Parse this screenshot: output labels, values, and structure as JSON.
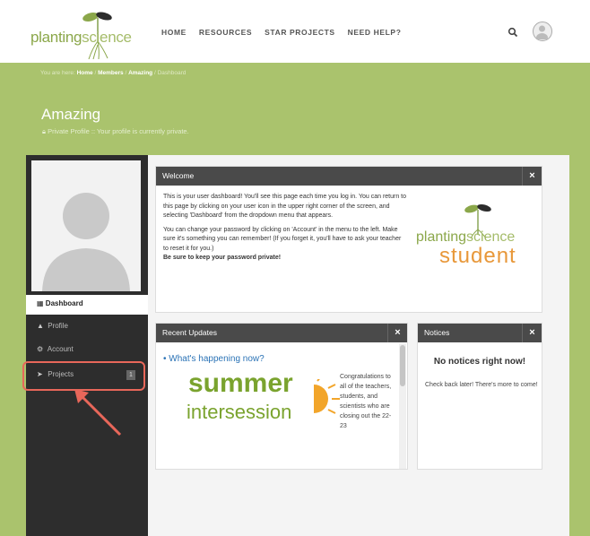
{
  "header": {
    "logo_left": "planting",
    "logo_right": "science",
    "nav": [
      "HOME",
      "RESOURCES",
      "STAR PROJECTS",
      "NEED HELP?"
    ]
  },
  "breadcrumb": {
    "prefix": "You are here:",
    "items": [
      "Home",
      "Members",
      "Amazing",
      "Dashboard"
    ],
    "separator": " / "
  },
  "profile": {
    "title": "Amazing",
    "privacy": "Private Profile :: Your profile is currently private."
  },
  "sidebar": {
    "dashboard": "Dashboard",
    "items": [
      {
        "label": "Profile",
        "icon": "user-icon"
      },
      {
        "label": "Account",
        "icon": "gears-icon"
      },
      {
        "label": "Projects",
        "icon": "paper-plane-icon",
        "badge": "1"
      }
    ]
  },
  "welcome": {
    "title": "Welcome",
    "close": "×",
    "paragraph1": "This is your user dashboard! You'll see this page each time you log in. You can return to this page by clicking on your user icon in the upper right corner of the screen, and selecting 'Dashboard' from the dropdown menu that appears.",
    "paragraph2": "You can change your password by clicking on 'Account' in the menu to the left. Make sure it's something you can remember! (If you forget it, you'll have to ask your teacher to reset it for you.)",
    "emphasis": "Be sure to keep your password private!",
    "logo_line1_left": "planting",
    "logo_line1_right": "science",
    "logo_line2": "student"
  },
  "updates": {
    "title": "Recent Updates",
    "close": "×",
    "link": "What's happening now?",
    "image_line1": "summer",
    "image_line2": "intersession",
    "text": "Congratulations to all of the teachers, students, and scientists who are closing out the 22-23"
  },
  "notices": {
    "title": "Notices",
    "close": "×",
    "heading": "No notices right now!",
    "body": "Check back later! There's more to come!"
  },
  "colors": {
    "brand_green": "#aac36d",
    "logo_green": "#8ba74a",
    "sidebar": "#2d2d2d",
    "panel_header": "#4a4a4a",
    "link_blue": "#2b73b6",
    "highlight_red": "#e8675a",
    "summer_green": "#7aa32e",
    "sun_orange": "#f2a52a"
  }
}
